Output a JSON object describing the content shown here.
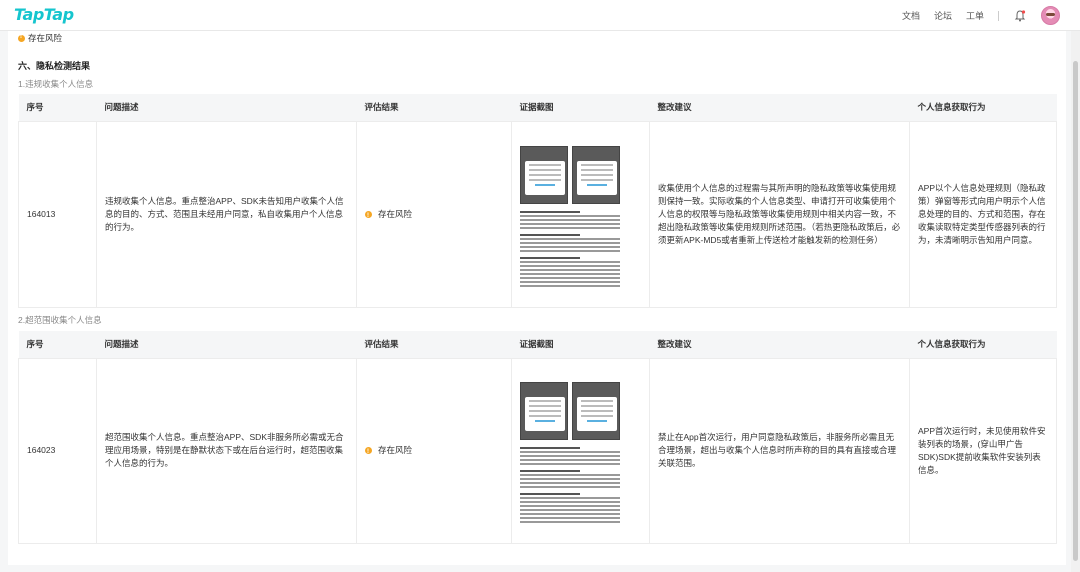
{
  "brand": "TapTap",
  "nav": {
    "links": [
      "文档",
      "论坛",
      "工单"
    ]
  },
  "top_risk": "存在风险",
  "section_title": "六、隐私检测结果",
  "tables": [
    {
      "subtitle": "1.违规收集个人信息",
      "headers": [
        "序号",
        "问题描述",
        "评估结果",
        "证据截图",
        "整改建议",
        "个人信息获取行为"
      ],
      "row": {
        "id": "164013",
        "desc": "违规收集个人信息。重点整治APP、SDK未告知用户收集个人信息的目的、方式、范围且未经用户同意，私自收集用户个人信息的行为。",
        "eval": "存在风险",
        "advice": "收集使用个人信息的过程需与其所声明的隐私政策等收集使用规则保持一致。实际收集的个人信息类型、申请打开可收集使用个人信息的权限等与隐私政策等收集使用规则中相关内容一致，不超出隐私政策等收集使用规则所述范围。（若热更隐私政策后，必须更新APK-MD5或者重新上传送检才能触发新的检测任务）",
        "behavior": "APP以个人信息处理规则（隐私政策）弹窗等形式向用户明示个人信息处理的目的、方式和范围，存在收集读取特定类型传感器列表的行为，未清晰明示告知用户同意。"
      }
    },
    {
      "subtitle": "2.超范围收集个人信息",
      "headers": [
        "序号",
        "问题描述",
        "评估结果",
        "证据截图",
        "整改建议",
        "个人信息获取行为"
      ],
      "row": {
        "id": "164023",
        "desc": "超范围收集个人信息。重点整治APP、SDK非服务所必需或无合理应用场景，特别是在静默状态下或在后台运行时，超范围收集个人信息的行为。",
        "eval": "存在风险",
        "advice": "禁止在App首次运行，用户同意隐私政策后，非服务所必需且无合理场景，超出与收集个人信息时所声称的目的具有直接或合理关联范围。",
        "behavior": "APP首次运行时，未见使用软件安装列表的场景，(穿山甲广告SDK)SDK提前收集软件安装列表信息。"
      }
    }
  ]
}
